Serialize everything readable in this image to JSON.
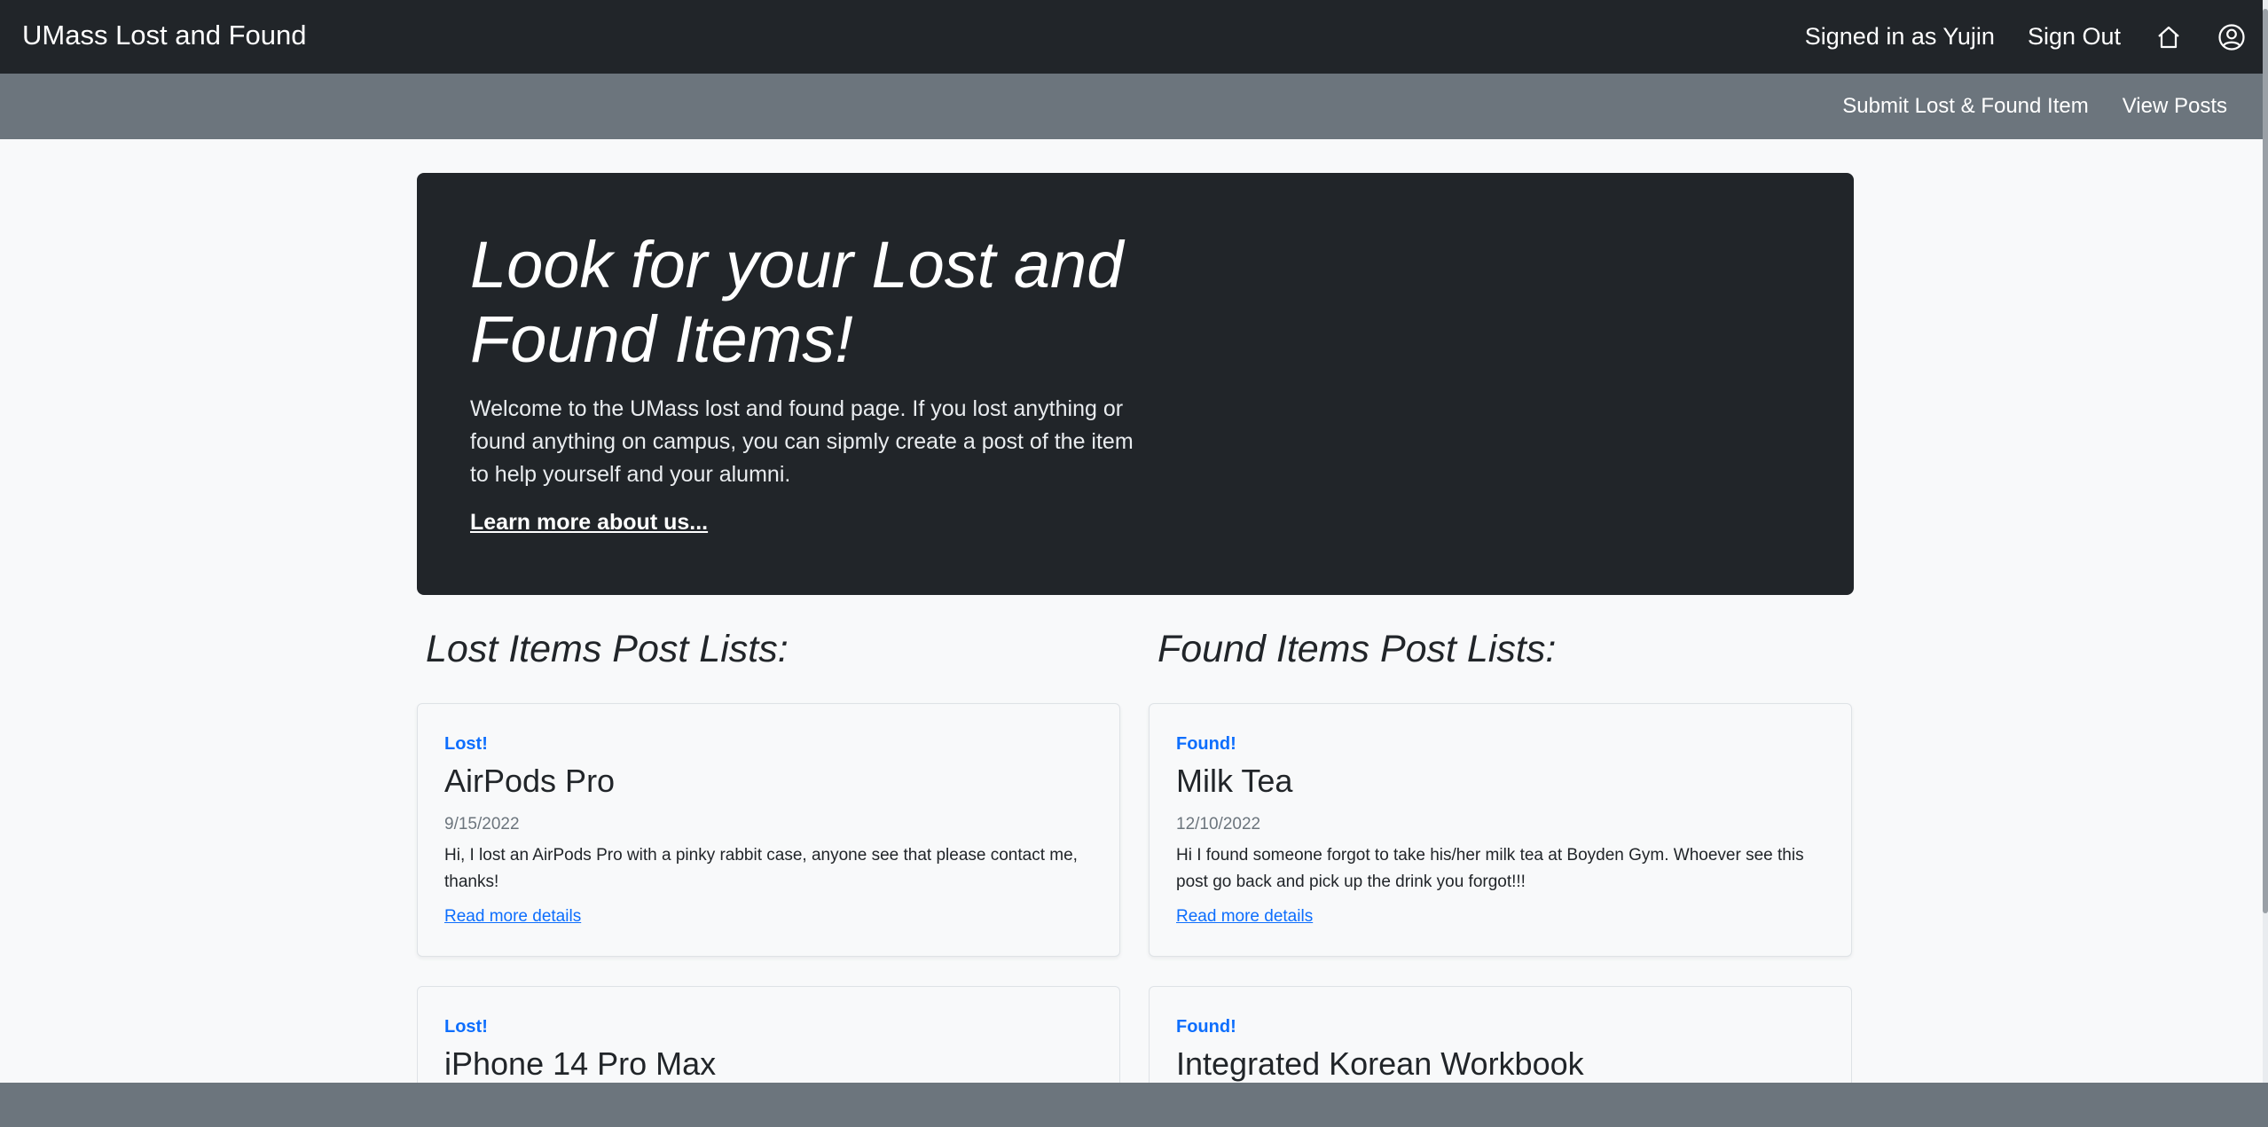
{
  "header": {
    "brand": "UMass Lost and Found",
    "signed_in": "Signed in as Yujin",
    "sign_out": "Sign Out",
    "home_icon": "home-icon",
    "profile_icon": "user-circle-icon"
  },
  "subnav": {
    "submit": "Submit Lost & Found Item",
    "view_posts": "View Posts"
  },
  "hero": {
    "title": "Look for your Lost and Found Items!",
    "body": "Welcome to the UMass lost and found page. If you lost anything or found anything on campus, you can sipmly create a post of the item to help yourself and your alumni.",
    "link": "Learn more about us..."
  },
  "lost": {
    "heading": "Lost Items Post Lists:",
    "posts": [
      {
        "tag": "Lost!",
        "title": "AirPods Pro",
        "date": "9/15/2022",
        "desc": "Hi, I lost an AirPods Pro with a pinky rabbit case, anyone see that please contact me, thanks!",
        "link": "Read more details"
      },
      {
        "tag": "Lost!",
        "title": "iPhone 14 Pro Max"
      }
    ]
  },
  "found": {
    "heading": "Found Items Post Lists:",
    "posts": [
      {
        "tag": "Found!",
        "title": "Milk Tea",
        "date": "12/10/2022",
        "desc": "Hi I found someone forgot to take his/her milk tea at Boyden Gym. Whoever see this post go back and pick up the drink you forgot!!!",
        "link": "Read more details"
      },
      {
        "tag": "Found!",
        "title": "Integrated Korean Workbook"
      }
    ]
  },
  "colors": {
    "navbar": "#212529",
    "subbar": "#6c757d",
    "accent": "#0d6efd",
    "page_bg": "#f8f9fa"
  }
}
